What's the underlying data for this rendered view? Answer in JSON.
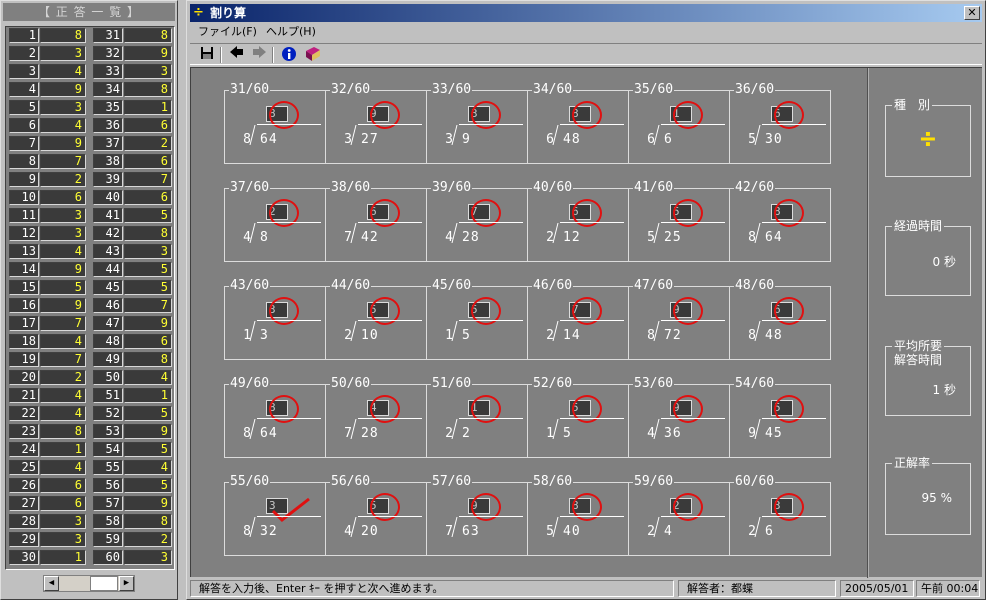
{
  "answer_list": {
    "title": "【 正 答 一 覧 】",
    "rows": [
      [
        "1",
        "8",
        "31",
        "8"
      ],
      [
        "2",
        "3",
        "32",
        "9"
      ],
      [
        "3",
        "4",
        "33",
        "3"
      ],
      [
        "4",
        "9",
        "34",
        "8"
      ],
      [
        "5",
        "3",
        "35",
        "1"
      ],
      [
        "6",
        "4",
        "36",
        "6"
      ],
      [
        "7",
        "9",
        "37",
        "2"
      ],
      [
        "8",
        "7",
        "38",
        "6"
      ],
      [
        "9",
        "2",
        "39",
        "7"
      ],
      [
        "10",
        "6",
        "40",
        "6"
      ],
      [
        "11",
        "3",
        "41",
        "5"
      ],
      [
        "12",
        "3",
        "42",
        "8"
      ],
      [
        "13",
        "4",
        "43",
        "3"
      ],
      [
        "14",
        "9",
        "44",
        "5"
      ],
      [
        "15",
        "5",
        "45",
        "5"
      ],
      [
        "16",
        "9",
        "46",
        "7"
      ],
      [
        "17",
        "7",
        "47",
        "9"
      ],
      [
        "18",
        "4",
        "48",
        "6"
      ],
      [
        "19",
        "7",
        "49",
        "8"
      ],
      [
        "20",
        "2",
        "50",
        "4"
      ],
      [
        "21",
        "4",
        "51",
        "1"
      ],
      [
        "22",
        "4",
        "52",
        "5"
      ],
      [
        "23",
        "8",
        "53",
        "9"
      ],
      [
        "24",
        "1",
        "54",
        "5"
      ],
      [
        "25",
        "4",
        "55",
        "4"
      ],
      [
        "26",
        "6",
        "56",
        "5"
      ],
      [
        "27",
        "6",
        "57",
        "9"
      ],
      [
        "28",
        "3",
        "58",
        "8"
      ],
      [
        "29",
        "3",
        "59",
        "2"
      ],
      [
        "30",
        "1",
        "60",
        "3"
      ]
    ]
  },
  "window": {
    "title_icon": "÷",
    "title": "割り算",
    "close": "✕"
  },
  "menu": [
    "ファイル(F)",
    "ヘルプ(H)"
  ],
  "toolbar_icons": [
    "save-icon",
    "back-arrow-icon",
    "forward-arrow-icon",
    "info-icon",
    "book-icon"
  ],
  "problems": [
    [
      {
        "label": "31/60",
        "answer": "8",
        "divisor": "8",
        "dividend": "64",
        "mark": "circle"
      },
      {
        "label": "32/60",
        "answer": "9",
        "divisor": "3",
        "dividend": "27",
        "mark": "circle"
      },
      {
        "label": "33/60",
        "answer": "3",
        "divisor": "3",
        "dividend": "9",
        "mark": "circle"
      },
      {
        "label": "34/60",
        "answer": "8",
        "divisor": "6",
        "dividend": "48",
        "mark": "circle"
      },
      {
        "label": "35/60",
        "answer": "1",
        "divisor": "6",
        "dividend": "6",
        "mark": "circle"
      },
      {
        "label": "36/60",
        "answer": "6",
        "divisor": "5",
        "dividend": "30",
        "mark": "circle"
      }
    ],
    [
      {
        "label": "37/60",
        "answer": "2",
        "divisor": "4",
        "dividend": "8",
        "mark": "circle"
      },
      {
        "label": "38/60",
        "answer": "6",
        "divisor": "7",
        "dividend": "42",
        "mark": "circle"
      },
      {
        "label": "39/60",
        "answer": "7",
        "divisor": "4",
        "dividend": "28",
        "mark": "circle"
      },
      {
        "label": "40/60",
        "answer": "6",
        "divisor": "2",
        "dividend": "12",
        "mark": "circle"
      },
      {
        "label": "41/60",
        "answer": "5",
        "divisor": "5",
        "dividend": "25",
        "mark": "circle"
      },
      {
        "label": "42/60",
        "answer": "8",
        "divisor": "8",
        "dividend": "64",
        "mark": "circle"
      }
    ],
    [
      {
        "label": "43/60",
        "answer": "3",
        "divisor": "1",
        "dividend": "3",
        "mark": "circle"
      },
      {
        "label": "44/60",
        "answer": "5",
        "divisor": "2",
        "dividend": "10",
        "mark": "circle"
      },
      {
        "label": "45/60",
        "answer": "5",
        "divisor": "1",
        "dividend": "5",
        "mark": "circle"
      },
      {
        "label": "46/60",
        "answer": "7",
        "divisor": "2",
        "dividend": "14",
        "mark": "circle"
      },
      {
        "label": "47/60",
        "answer": "9",
        "divisor": "8",
        "dividend": "72",
        "mark": "circle"
      },
      {
        "label": "48/60",
        "answer": "6",
        "divisor": "8",
        "dividend": "48",
        "mark": "circle"
      }
    ],
    [
      {
        "label": "49/60",
        "answer": "8",
        "divisor": "8",
        "dividend": "64",
        "mark": "circle"
      },
      {
        "label": "50/60",
        "answer": "4",
        "divisor": "7",
        "dividend": "28",
        "mark": "circle"
      },
      {
        "label": "51/60",
        "answer": "1",
        "divisor": "2",
        "dividend": "2",
        "mark": "circle"
      },
      {
        "label": "52/60",
        "answer": "5",
        "divisor": "1",
        "dividend": "5",
        "mark": "circle"
      },
      {
        "label": "53/60",
        "answer": "9",
        "divisor": "4",
        "dividend": "36",
        "mark": "circle"
      },
      {
        "label": "54/60",
        "answer": "5",
        "divisor": "9",
        "dividend": "45",
        "mark": "circle"
      }
    ],
    [
      {
        "label": "55/60",
        "answer": "3",
        "divisor": "8",
        "dividend": "32",
        "mark": "check"
      },
      {
        "label": "56/60",
        "answer": "5",
        "divisor": "4",
        "dividend": "20",
        "mark": "circle"
      },
      {
        "label": "57/60",
        "answer": "9",
        "divisor": "7",
        "dividend": "63",
        "mark": "circle"
      },
      {
        "label": "58/60",
        "answer": "8",
        "divisor": "5",
        "dividend": "40",
        "mark": "circle"
      },
      {
        "label": "59/60",
        "answer": "2",
        "divisor": "2",
        "dividend": "4",
        "mark": "circle"
      },
      {
        "label": "60/60",
        "answer": "3",
        "divisor": "2",
        "dividend": "6",
        "mark": "circle"
      }
    ]
  ],
  "stats": {
    "kind_label": "種　別",
    "kind_value": "÷",
    "elapsed_label": "経過時間",
    "elapsed_value": "0 秒",
    "avg_label_1": "平均所要",
    "avg_label_2": "解答時間",
    "avg_value": "1 秒",
    "rate_label": "正解率",
    "rate_value": "95 %"
  },
  "status": {
    "message": "解答を入力後、Enter ｷｰ を押すと次へ進めます。",
    "user": "解答者：都蝶",
    "date": "2005/05/01",
    "time": "午前 00:04"
  },
  "colors": {
    "mark_red": "#e01010",
    "answer_yellow": "#ffff33",
    "title_blue": "#0a246a",
    "kind_yellow": "#ffe000"
  }
}
